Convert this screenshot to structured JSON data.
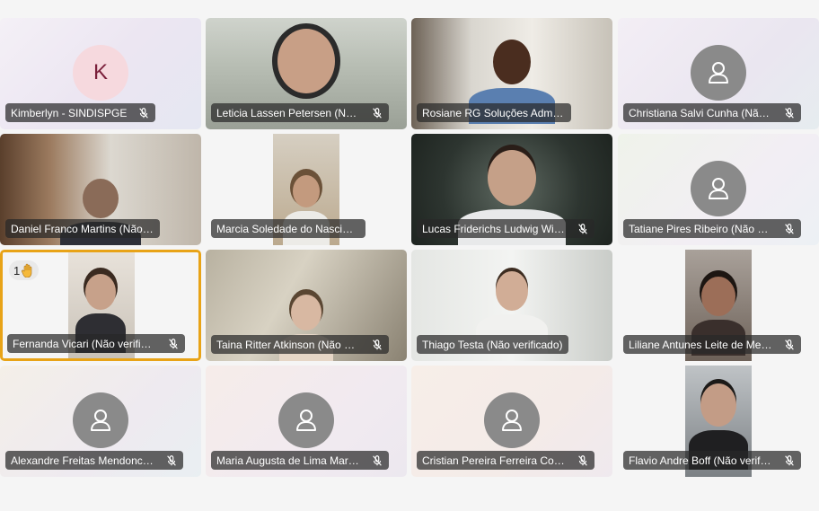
{
  "participants": [
    {
      "name": "Kimberlyn - SINDISPGE",
      "display": "Kimberlyn - SINDISPGE",
      "type": "initial",
      "initial": "K",
      "muted": true
    },
    {
      "name": "Leticia Lassen Petersen (Não verificado)",
      "display": "Leticia Lassen Petersen (Não ...",
      "type": "video",
      "muted": true
    },
    {
      "name": "Rosiane RG Soluções Administrativas",
      "display": "Rosiane RG Soluções Administrati...",
      "type": "video",
      "muted": false
    },
    {
      "name": "Christiana Salvi Cunha (Não verificado)",
      "display": "Christiana Salvi Cunha (Não v...",
      "type": "avatar",
      "muted": true
    },
    {
      "name": "Daniel Franco Martins (Não verificado)",
      "display": "Daniel Franco Martins (Não verific...",
      "type": "video",
      "muted": false
    },
    {
      "name": "Marcia Soledade do Nascimento",
      "display": "Marcia Soledade do Nascimento (...",
      "type": "video",
      "muted": false
    },
    {
      "name": "Lucas Friderichs Ludwig Wickert",
      "display": "Lucas Friderichs Ludwig Wick...",
      "type": "video",
      "muted": true
    },
    {
      "name": "Tatiane Pires Ribeiro (Não verificado)",
      "display": "Tatiane Pires Ribeiro (Não ver...",
      "type": "avatar",
      "muted": true
    },
    {
      "name": "Fernanda Vicari (Não verificado)",
      "display": "Fernanda Vicari (Não verifica...",
      "type": "video",
      "muted": true,
      "active": true,
      "hand_count": "1",
      "hand_icon": "raised-hand-icon"
    },
    {
      "name": "Taina Ritter Atkinson (Não verificado)",
      "display": "Taina Ritter Atkinson (Não ver...",
      "type": "video",
      "muted": true
    },
    {
      "name": "Thiago Testa (Não verificado)",
      "display": "Thiago Testa (Não verificado)",
      "type": "video",
      "muted": false
    },
    {
      "name": "Liliane Antunes Leite de Medeiros",
      "display": "Liliane Antunes Leite de Med...",
      "type": "video",
      "muted": true
    },
    {
      "name": "Alexandre Freitas Mendonca (Não verificado)",
      "display": "Alexandre Freitas Mendonca (...",
      "type": "avatar",
      "muted": true
    },
    {
      "name": "Maria Augusta de Lima Mariano",
      "display": "Maria Augusta de Lima Maria...",
      "type": "avatar",
      "muted": true
    },
    {
      "name": "Cristian Pereira Ferreira Costa",
      "display": "Cristian Pereira Ferreira Costa...",
      "type": "avatar",
      "muted": true
    },
    {
      "name": "Flavio Andre Boff (Não verificado)",
      "display": "Flavio Andre Boff (Não verific...",
      "type": "video",
      "muted": true
    }
  ],
  "colors": {
    "active_border": "#e8a317",
    "label_bg": "#282828",
    "avatar_gray": "#8a8a8a",
    "initial_bg": "#f6d9de",
    "initial_fg": "#7a1f3a"
  },
  "icons": {
    "muted": "mic-off-icon",
    "person": "person-icon",
    "hand": "raised-hand-icon"
  }
}
